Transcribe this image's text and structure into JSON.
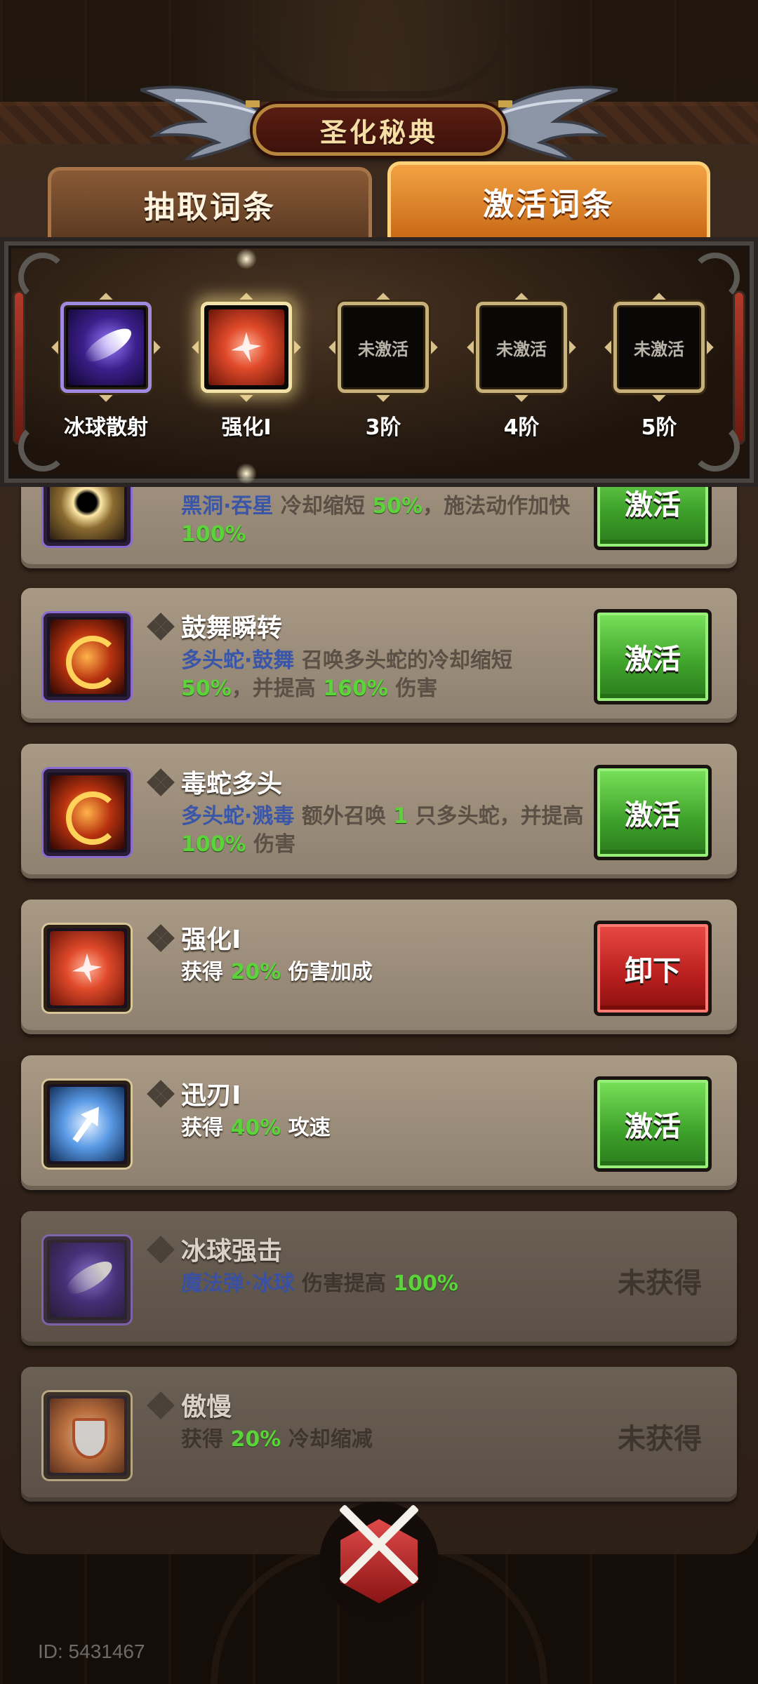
{
  "header": {
    "title": "圣化秘典"
  },
  "tabs": [
    {
      "label": "抽取词条",
      "active": false
    },
    {
      "label": "激活词条",
      "active": true
    }
  ],
  "slots": [
    {
      "label": "冰球散射",
      "icon": "ice-orb-icon",
      "state": "filled"
    },
    {
      "label": "强化Ⅰ",
      "icon": "power-burst-icon",
      "state": "selected"
    },
    {
      "label": "3阶",
      "empty_text": "未激活",
      "state": "empty"
    },
    {
      "label": "4阶",
      "empty_text": "未激活",
      "state": "empty"
    },
    {
      "label": "5阶",
      "empty_text": "未激活",
      "state": "empty"
    }
  ],
  "cards": [
    {
      "icon": "black-hole-icon",
      "title": "",
      "desc": {
        "kw": "黑洞·吞星",
        "t1": " 冷却缩短 ",
        "n1": "50%",
        "t2": "，施法动作加快 ",
        "n2": "100%"
      },
      "action": "激活"
    },
    {
      "icon": "hydra-dragon-icon",
      "title": "鼓舞瞬转",
      "desc": {
        "kw": "多头蛇·鼓舞",
        "t1": " 召唤多头蛇的冷却缩短 ",
        "n1": "50%",
        "t2": "，并提高 ",
        "n2": "160%",
        "t3": " 伤害"
      },
      "action": "激活"
    },
    {
      "icon": "hydra-dragon-icon",
      "title": "毒蛇多头",
      "desc": {
        "kw": "多头蛇·溅毒",
        "t1": " 额外召唤 ",
        "n1": "1",
        "t2": " 只多头蛇，并提高 ",
        "n2": "100%",
        "t3": " 伤害"
      },
      "action": "激活"
    },
    {
      "icon": "power-burst-icon",
      "title": "强化Ⅰ",
      "desc": {
        "t1": "获得 ",
        "n1": "20%",
        "t2": " 伤害加成"
      },
      "action": "卸下"
    },
    {
      "icon": "swift-blade-icon",
      "title": "迅刃Ⅰ",
      "desc": {
        "t1": "获得 ",
        "n1": "40%",
        "t2": " 攻速"
      },
      "action": "激活"
    },
    {
      "icon": "ice-orb-icon",
      "title": "冰球强击",
      "desc": {
        "kw": "魔法弹·冰球",
        "t1": " 伤害提高 ",
        "n1": "100%"
      },
      "status": "未获得"
    },
    {
      "icon": "pride-shield-icon",
      "title": "傲慢",
      "desc": {
        "t1": "获得 ",
        "n1": "20%",
        "t2": " 冷却缩减"
      },
      "status": "未获得"
    }
  ],
  "footer": {
    "id_text": "ID: 5431467"
  }
}
